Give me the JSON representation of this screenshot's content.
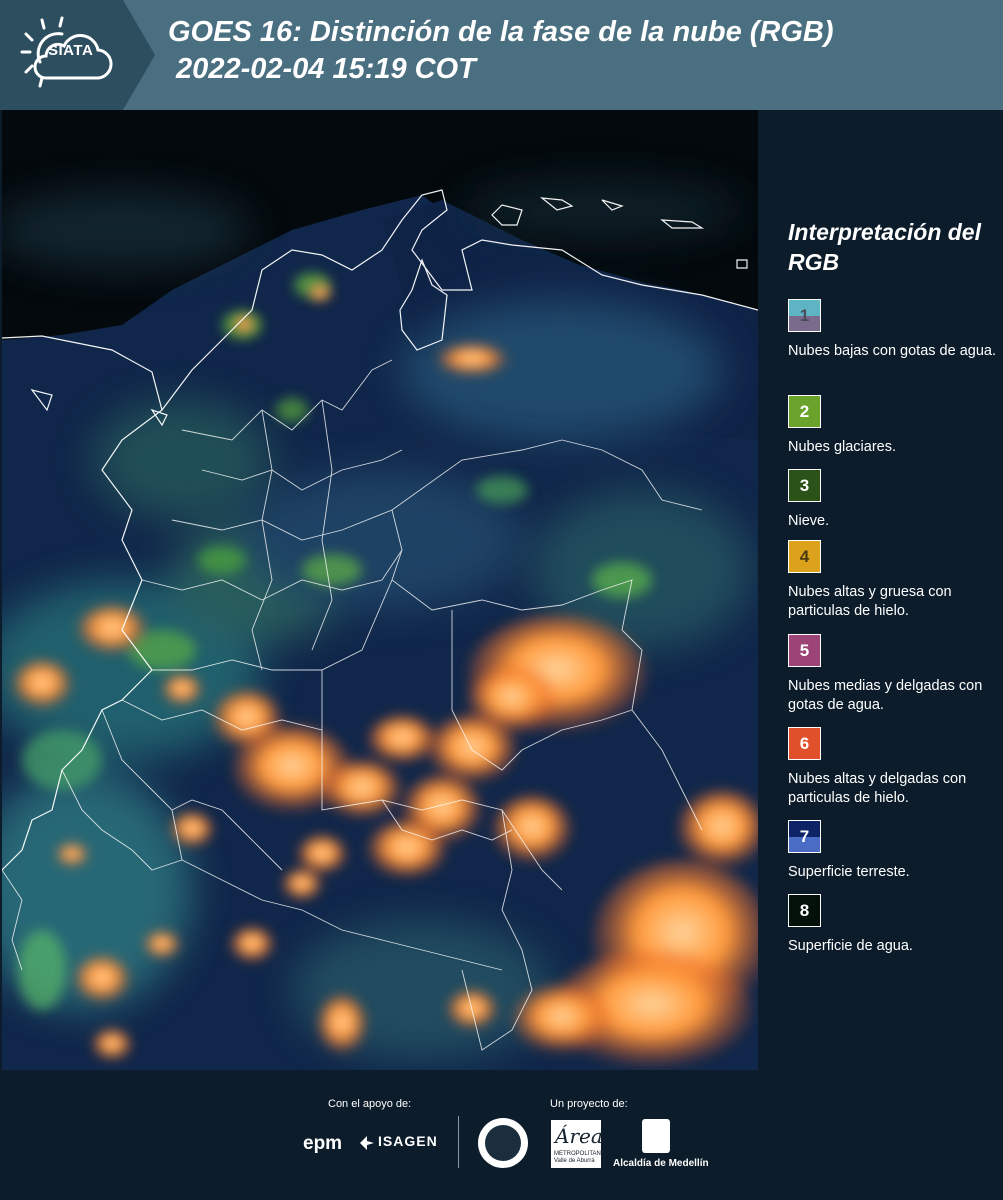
{
  "header": {
    "logo_text": "SIATA",
    "title_line1": "GOES 16: Distinción de la fase de la nube (RGB)",
    "title_line2": " 2022-02-04 15:19 COT"
  },
  "map": {
    "description_icon": "goes16-cloud-phase-rgb-map"
  },
  "legend": {
    "title": "Interpretación del RGB",
    "items": [
      {
        "number": "1",
        "top_color": "#5fb4c3",
        "bottom_color": "#7a6a8c",
        "num_color": "#4a4a5a",
        "text": "Nubes bajas con gotas de agua."
      },
      {
        "number": "2",
        "top_color": "#6aa22c",
        "bottom_color": "#6aa22c",
        "num_color": "#ffffff",
        "text": "Nubes glaciares."
      },
      {
        "number": "3",
        "top_color": "#2b5218",
        "bottom_color": "#2b5218",
        "num_color": "#ffffff",
        "text": "Nieve."
      },
      {
        "number": "4",
        "top_color": "#dca21c",
        "bottom_color": "#dca21c",
        "num_color": "#4a3a10",
        "text": "Nubes altas y gruesa con particulas de hielo."
      },
      {
        "number": "5",
        "top_color": "#9c4478",
        "bottom_color": "#9c4478",
        "num_color": "#ffffff",
        "text": "Nubes medias y delgadas con gotas de agua."
      },
      {
        "number": "6",
        "top_color": "#e0502a",
        "bottom_color": "#e0502a",
        "num_color": "#ffffff",
        "text": "Nubes altas y delgadas con particulas de hielo."
      },
      {
        "number": "7",
        "top_color": "#0e2266",
        "bottom_color": "#4a6cc4",
        "num_color": "#ffffff",
        "text": "Superficie terreste."
      },
      {
        "number": "8",
        "top_color": "#04100a",
        "bottom_color": "#04100a",
        "num_color": "#ffffff",
        "text": "Superficie de agua."
      }
    ]
  },
  "footer": {
    "support_label": "Con el apoyo de:",
    "project_label": "Un proyecto de:",
    "epm": "epm",
    "isagen": "ISAGEN",
    "amva_script": "Área",
    "amva_small": "METROPOLITANA Valle de Aburrá",
    "medellin": "Alcaldía de Medellín"
  }
}
